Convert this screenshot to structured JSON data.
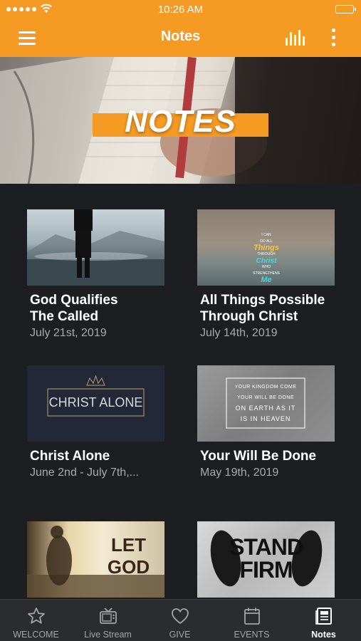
{
  "status_bar": {
    "time": "10:26 AM"
  },
  "nav": {
    "title": "Notes"
  },
  "hero": {
    "title": "NOTES"
  },
  "cards": [
    {
      "title_line1": "God Qualifies",
      "title_line2": "The Called",
      "date": "July 21st, 2019"
    },
    {
      "title_line1": "All Things Possible",
      "title_line2": "Through Christ",
      "date": "July 14th, 2019",
      "thumb_lines": [
        "I CAN",
        "DO ALL",
        "Things",
        "THROUGH",
        "Christ",
        "WHO",
        "STRENGTHENS",
        "Me"
      ]
    },
    {
      "title_line1": "Christ Alone",
      "date": "June 2nd - July 7th,...",
      "thumb_text": "CHRIST ALONE"
    },
    {
      "title_line1": "Your Will Be Done",
      "date": "May 19th, 2019",
      "thumb_lines": [
        "YOUR KINGDOM COME",
        "YOUR WILL BE DONE",
        "ON EARTH AS IT",
        "IS IN HEAVEN"
      ]
    },
    {
      "thumb_text": "LET GOD"
    },
    {
      "thumb_lines": [
        "STAND",
        "FIRM"
      ]
    }
  ],
  "tabs": [
    {
      "label": "WELCOME",
      "icon": "star-icon"
    },
    {
      "label": "Live Stream",
      "icon": "tv-icon"
    },
    {
      "label": "GIVE",
      "icon": "heart-icon"
    },
    {
      "label": "EVENTS",
      "icon": "calendar-icon"
    },
    {
      "label": "Notes",
      "icon": "notes-icon",
      "active": true
    }
  ],
  "colors": {
    "accent": "#f59a23",
    "background": "#1d1e21",
    "tab_bar": "#2b2c2f",
    "secondary_text": "#a9aaad"
  }
}
